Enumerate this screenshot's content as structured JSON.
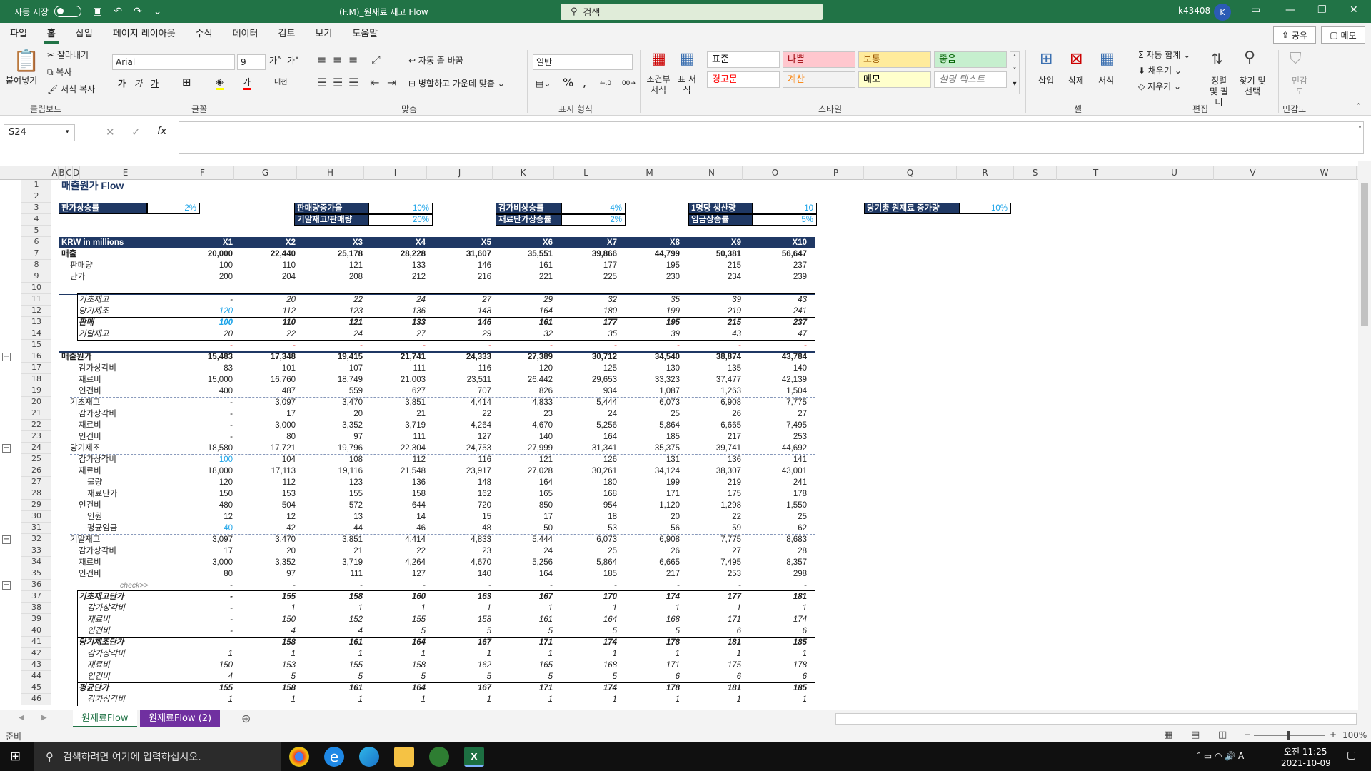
{
  "titlebar": {
    "autosave": "자동 저장",
    "doc_title": "(F.M)_원재료 재고 Flow",
    "search": "검색",
    "user": "k43408",
    "avatar": "K"
  },
  "menu": [
    "파일",
    "홈",
    "삽입",
    "페이지 레이아웃",
    "수식",
    "데이터",
    "검토",
    "보기",
    "도움말"
  ],
  "share": "공유",
  "memo": "메모",
  "ribbon": {
    "paste": "붙여넣기",
    "cut": "잘라내기",
    "copy": "복사",
    "format_painter": "서식 복사",
    "clipboard": "클립보드",
    "font_name": "Arial",
    "font_size": "9",
    "font": "글꼴",
    "wrap": "자동 줄 바꿈",
    "merge": "병합하고 가운데 맞춤",
    "align": "맞춤",
    "number_format": "일반",
    "number": "표시 형식",
    "cond_format": "조건부 서식",
    "table_format": "표 서식",
    "styles": "스타일",
    "style_cells": [
      {
        "label": "표준",
        "bg": "#ffffff",
        "color": "#000000"
      },
      {
        "label": "나쁨",
        "bg": "#ffc7ce",
        "color": "#9c0006"
      },
      {
        "label": "보통",
        "bg": "#ffeb9c",
        "color": "#9c5700"
      },
      {
        "label": "좋음",
        "bg": "#c6efce",
        "color": "#006100"
      },
      {
        "label": "경고문",
        "bg": "#ffffff",
        "color": "#ff0000"
      },
      {
        "label": "계산",
        "bg": "#f2f2f2",
        "color": "#fa7d00"
      },
      {
        "label": "메모",
        "bg": "#ffffcc",
        "color": "#000000"
      },
      {
        "label": "설명 텍스트",
        "bg": "#ffffff",
        "color": "#7f7f7f"
      }
    ],
    "insert": "삽입",
    "delete": "삭제",
    "format": "서식",
    "cells": "셀",
    "autosum": "자동 합계",
    "fill": "채우기",
    "clear": "지우기",
    "sort": "정렬 및 필터",
    "find": "찾기 및 선택",
    "editing": "편집",
    "sensitivity": "민감도"
  },
  "namebox": "S24",
  "columns": [
    "A",
    "B",
    "C",
    "D",
    "E",
    "F",
    "G",
    "H",
    "I",
    "J",
    "K",
    "L",
    "M",
    "N",
    "O",
    "P",
    "Q",
    "R",
    "S",
    "T",
    "U",
    "V",
    "W"
  ],
  "sheet": {
    "title": "매출원가 Flow",
    "params": [
      {
        "label": "판가상승률",
        "value": "2%"
      },
      {
        "label": "판매량증가율",
        "value": "10%"
      },
      {
        "label": "기말재고/판매량",
        "value": "20%"
      },
      {
        "label": "감가비상승률",
        "value": "4%"
      },
      {
        "label": "재료단가상승률",
        "value": "2%"
      },
      {
        "label": "1명당 생산량",
        "value": "10"
      },
      {
        "label": "임금상승률",
        "value": "5%"
      },
      {
        "label": "당기총 원재료 증가량",
        "value": "10%"
      }
    ],
    "header": {
      "label": "KRW in millions",
      "years": [
        "X1",
        "X2",
        "X3",
        "X4",
        "X5",
        "X6",
        "X7",
        "X8",
        "X9",
        "X10"
      ]
    },
    "rows": [
      {
        "n": "7",
        "label": "매출",
        "indent": 0,
        "b": true,
        "v": [
          "20,000",
          "22,440",
          "25,178",
          "28,228",
          "31,607",
          "35,551",
          "39,866",
          "44,799",
          "50,381",
          "56,647"
        ]
      },
      {
        "n": "8",
        "label": "판매량",
        "indent": 1,
        "v": [
          "100",
          "110",
          "121",
          "133",
          "146",
          "161",
          "177",
          "195",
          "215",
          "237"
        ]
      },
      {
        "n": "9",
        "label": "단가",
        "indent": 1,
        "v": [
          "200",
          "204",
          "208",
          "212",
          "216",
          "221",
          "225",
          "230",
          "234",
          "239"
        ]
      },
      {
        "n": "10",
        "label": "",
        "v": []
      },
      {
        "n": "11",
        "label": "기초재고",
        "indent": 2,
        "it": true,
        "v": [
          "-",
          "20",
          "22",
          "24",
          "27",
          "29",
          "32",
          "35",
          "39",
          "43"
        ]
      },
      {
        "n": "12",
        "label": "당기제조",
        "indent": 2,
        "it": true,
        "v": [
          "120",
          "112",
          "123",
          "136",
          "148",
          "164",
          "180",
          "199",
          "219",
          "241"
        ],
        "blue0": true
      },
      {
        "n": "13",
        "label": "판매",
        "indent": 2,
        "it": true,
        "b": true,
        "v": [
          "100",
          "110",
          "121",
          "133",
          "146",
          "161",
          "177",
          "195",
          "215",
          "237"
        ],
        "blue0": true
      },
      {
        "n": "14",
        "label": "기말재고",
        "indent": 2,
        "it": true,
        "v": [
          "20",
          "22",
          "24",
          "27",
          "29",
          "32",
          "35",
          "39",
          "43",
          "47"
        ]
      },
      {
        "n": "15",
        "label": "",
        "v": [
          "-",
          "-",
          "-",
          "-",
          "-",
          "-",
          "-",
          "-",
          "-",
          "-"
        ],
        "red": true
      },
      {
        "n": "16",
        "label": "매출원가",
        "indent": 0,
        "b": true,
        "v": [
          "15,483",
          "17,348",
          "19,415",
          "21,741",
          "24,333",
          "27,389",
          "30,712",
          "34,540",
          "38,874",
          "43,784"
        ]
      },
      {
        "n": "17",
        "label": "감가상각비",
        "indent": 2,
        "v": [
          "83",
          "101",
          "107",
          "111",
          "116",
          "120",
          "125",
          "130",
          "135",
          "140"
        ]
      },
      {
        "n": "18",
        "label": "재료비",
        "indent": 2,
        "v": [
          "15,000",
          "16,760",
          "18,749",
          "21,003",
          "23,511",
          "26,442",
          "29,653",
          "33,323",
          "37,477",
          "42,139"
        ]
      },
      {
        "n": "19",
        "label": "인건비",
        "indent": 2,
        "v": [
          "400",
          "487",
          "559",
          "627",
          "707",
          "826",
          "934",
          "1,087",
          "1,263",
          "1,504"
        ]
      },
      {
        "n": "20",
        "label": "기초재고",
        "indent": 1,
        "v": [
          "-",
          "3,097",
          "3,470",
          "3,851",
          "4,414",
          "4,833",
          "5,444",
          "6,073",
          "6,908",
          "7,775"
        ]
      },
      {
        "n": "21",
        "label": "감가상각비",
        "indent": 2,
        "v": [
          "-",
          "17",
          "20",
          "21",
          "22",
          "23",
          "24",
          "25",
          "26",
          "27"
        ]
      },
      {
        "n": "22",
        "label": "재료비",
        "indent": 2,
        "v": [
          "-",
          "3,000",
          "3,352",
          "3,719",
          "4,264",
          "4,670",
          "5,256",
          "5,864",
          "6,665",
          "7,495"
        ]
      },
      {
        "n": "23",
        "label": "인건비",
        "indent": 2,
        "v": [
          "-",
          "80",
          "97",
          "111",
          "127",
          "140",
          "164",
          "185",
          "217",
          "253"
        ]
      },
      {
        "n": "24",
        "label": "당기제조",
        "indent": 1,
        "v": [
          "18,580",
          "17,721",
          "19,796",
          "22,304",
          "24,753",
          "27,999",
          "31,341",
          "35,375",
          "39,741",
          "44,692"
        ]
      },
      {
        "n": "25",
        "label": "감가상각비",
        "indent": 2,
        "v": [
          "100",
          "104",
          "108",
          "112",
          "116",
          "121",
          "126",
          "131",
          "136",
          "141"
        ],
        "blue0": true
      },
      {
        "n": "26",
        "label": "재료비",
        "indent": 2,
        "v": [
          "18,000",
          "17,113",
          "19,116",
          "21,548",
          "23,917",
          "27,028",
          "30,261",
          "34,124",
          "38,307",
          "43,001"
        ]
      },
      {
        "n": "27",
        "label": "물량",
        "indent": 3,
        "v": [
          "120",
          "112",
          "123",
          "136",
          "148",
          "164",
          "180",
          "199",
          "219",
          "241"
        ]
      },
      {
        "n": "28",
        "label": "재료단가",
        "indent": 3,
        "v": [
          "150",
          "153",
          "155",
          "158",
          "162",
          "165",
          "168",
          "171",
          "175",
          "178"
        ]
      },
      {
        "n": "29",
        "label": "인건비",
        "indent": 2,
        "v": [
          "480",
          "504",
          "572",
          "644",
          "720",
          "850",
          "954",
          "1,120",
          "1,298",
          "1,550"
        ]
      },
      {
        "n": "30",
        "label": "인원",
        "indent": 3,
        "v": [
          "12",
          "12",
          "13",
          "14",
          "15",
          "17",
          "18",
          "20",
          "22",
          "25"
        ]
      },
      {
        "n": "31",
        "label": "평균임금",
        "indent": 3,
        "v": [
          "40",
          "42",
          "44",
          "46",
          "48",
          "50",
          "53",
          "56",
          "59",
          "62"
        ],
        "blue0": true
      },
      {
        "n": "32",
        "label": "기말재고",
        "indent": 1,
        "v": [
          "3,097",
          "3,470",
          "3,851",
          "4,414",
          "4,833",
          "5,444",
          "6,073",
          "6,908",
          "7,775",
          "8,683"
        ]
      },
      {
        "n": "33",
        "label": "감가상각비",
        "indent": 2,
        "v": [
          "17",
          "20",
          "21",
          "22",
          "23",
          "24",
          "25",
          "26",
          "27",
          "28"
        ]
      },
      {
        "n": "34",
        "label": "재료비",
        "indent": 2,
        "v": [
          "3,000",
          "3,352",
          "3,719",
          "4,264",
          "4,670",
          "5,256",
          "5,864",
          "6,665",
          "7,495",
          "8,357"
        ]
      },
      {
        "n": "35",
        "label": "인건비",
        "indent": 2,
        "v": [
          "80",
          "97",
          "111",
          "127",
          "140",
          "164",
          "185",
          "217",
          "253",
          "298"
        ]
      },
      {
        "n": "36",
        "label": "check>>",
        "check": true,
        "v": [
          "-",
          "-",
          "-",
          "-",
          "-",
          "-",
          "-",
          "-",
          "-",
          "-"
        ]
      },
      {
        "n": "37",
        "label": "기초재고단가",
        "indent": 2,
        "it": true,
        "b": true,
        "v": [
          "-",
          "155",
          "158",
          "160",
          "163",
          "167",
          "170",
          "174",
          "177",
          "181"
        ]
      },
      {
        "n": "38",
        "label": "감가상각비",
        "indent": 3,
        "it": true,
        "v": [
          "-",
          "1",
          "1",
          "1",
          "1",
          "1",
          "1",
          "1",
          "1",
          "1"
        ]
      },
      {
        "n": "39",
        "label": "재료비",
        "indent": 3,
        "it": true,
        "v": [
          "-",
          "150",
          "152",
          "155",
          "158",
          "161",
          "164",
          "168",
          "171",
          "174"
        ]
      },
      {
        "n": "40",
        "label": "인건비",
        "indent": 3,
        "it": true,
        "v": [
          "-",
          "4",
          "4",
          "5",
          "5",
          "5",
          "5",
          "5",
          "6",
          "6"
        ]
      },
      {
        "n": "41",
        "label": "당기제조단가",
        "indent": 2,
        "it": true,
        "b": true,
        "v": [
          "",
          "158",
          "161",
          "164",
          "167",
          "171",
          "174",
          "178",
          "181",
          "185"
        ]
      },
      {
        "n": "42",
        "label": "감가상각비",
        "indent": 3,
        "it": true,
        "v": [
          "1",
          "1",
          "1",
          "1",
          "1",
          "1",
          "1",
          "1",
          "1",
          "1"
        ]
      },
      {
        "n": "43",
        "label": "재료비",
        "indent": 3,
        "it": true,
        "v": [
          "150",
          "153",
          "155",
          "158",
          "162",
          "165",
          "168",
          "171",
          "175",
          "178"
        ]
      },
      {
        "n": "44",
        "label": "인건비",
        "indent": 3,
        "it": true,
        "v": [
          "4",
          "5",
          "5",
          "5",
          "5",
          "5",
          "5",
          "6",
          "6",
          "6"
        ]
      },
      {
        "n": "45",
        "label": "평균단가",
        "indent": 2,
        "it": true,
        "b": true,
        "v": [
          "155",
          "158",
          "161",
          "164",
          "167",
          "171",
          "174",
          "178",
          "181",
          "185"
        ]
      },
      {
        "n": "46",
        "label": "감가상각비",
        "indent": 3,
        "it": true,
        "v": [
          "1",
          "1",
          "1",
          "1",
          "1",
          "1",
          "1",
          "1",
          "1",
          "1"
        ]
      }
    ]
  },
  "tabs": [
    "원재료Flow",
    "원재료Flow (2)"
  ],
  "status": {
    "ready": "준비",
    "zoom": "100%"
  },
  "taskbar": {
    "search": "검색하려면 여기에 입력하십시오.",
    "time": "오전 11:25",
    "date": "2021-10-09"
  }
}
